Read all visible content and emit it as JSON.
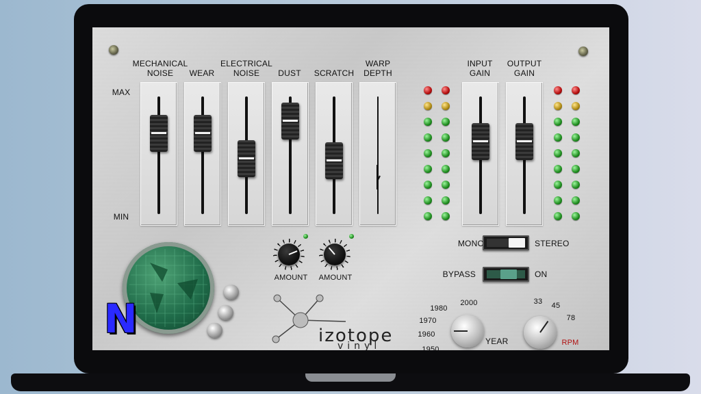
{
  "app": {
    "brand": "izotope",
    "product": "vinyl",
    "logo_letter": "N"
  },
  "scale": {
    "max": "MAX",
    "min": "MIN"
  },
  "faders": [
    {
      "label_line1": "MECHANICAL",
      "label_line2": "NOISE",
      "level": 0.72
    },
    {
      "label_line1": "WEAR",
      "label_line2": "",
      "level": 0.72
    },
    {
      "label_line1": "ELECTRICAL",
      "label_line2": "NOISE",
      "level": 0.45
    },
    {
      "label_line1": "DUST",
      "label_line2": "",
      "level": 0.85
    },
    {
      "label_line1": "SCRATCH",
      "label_line2": "",
      "level": 0.43
    },
    {
      "label_line1": "WARP",
      "label_line2": "DEPTH",
      "level": 0.35
    }
  ],
  "gain_faders": [
    {
      "label_line1": "INPUT",
      "label_line2": "GAIN",
      "level": 0.63
    },
    {
      "label_line1": "OUTPUT",
      "label_line2": "GAIN",
      "level": 0.63
    }
  ],
  "amount_knobs": [
    {
      "label": "AMOUNT",
      "value": 0.75
    },
    {
      "label": "AMOUNT",
      "value": 0.35
    }
  ],
  "switches": {
    "mode": {
      "left_label": "MONO",
      "right_label": "STEREO",
      "position": "right"
    },
    "bypass": {
      "left_label": "BYPASS",
      "right_label": "ON",
      "position": "right"
    }
  },
  "year_dial": {
    "label": "YEAR",
    "marks": [
      "1950",
      "1960",
      "1970",
      "1980",
      "2000"
    ],
    "selected": "1960"
  },
  "rpm_dial": {
    "label": "RPM",
    "marks": [
      "33",
      "45",
      "78"
    ],
    "selected": "45"
  },
  "colors": {
    "rpm_label": "#b01010",
    "logo": "#2a2aff",
    "led_red": "#b40d0d",
    "led_yellow": "#b08b14",
    "led_green": "#1f8d1f",
    "disc": "#1f6b49"
  }
}
